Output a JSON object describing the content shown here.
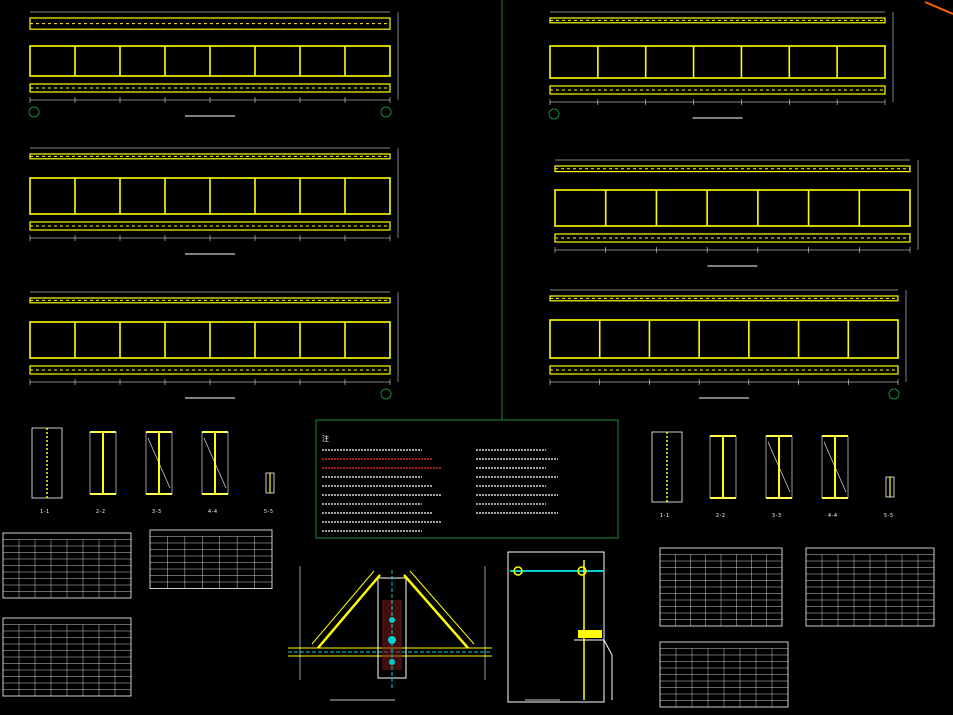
{
  "beams": [
    {
      "id": "beam-top-left",
      "left_tag": "①",
      "right_tag": "②"
    },
    {
      "id": "beam-mid-left-1",
      "left_tag": "",
      "right_tag": ""
    },
    {
      "id": "beam-mid-left-2",
      "left_tag": "",
      "right_tag": "⑤"
    },
    {
      "id": "beam-top-right",
      "left_tag": "⑦",
      "right_tag": ""
    },
    {
      "id": "beam-mid-right-1",
      "left_tag": "",
      "right_tag": ""
    },
    {
      "id": "beam-mid-right-2",
      "left_tag": "",
      "right_tag": "⑥"
    }
  ],
  "notes": {
    "title": "注"
  },
  "sections_left": [
    "1-1",
    "2-2",
    "3-3",
    "4-4",
    "5-5"
  ],
  "sections_right": [
    "1-1",
    "2-2",
    "3-3",
    "4-4",
    "5-5"
  ],
  "colors": {
    "background": "#000000",
    "beam": "#ffff00",
    "line": "#ffffff",
    "divider": "#1a8a3a",
    "notes_frame": "#1a8a3a",
    "red_text": "#ff3030",
    "accent_cyan": "#00d0d0",
    "corner_mark": "#ff6000"
  }
}
